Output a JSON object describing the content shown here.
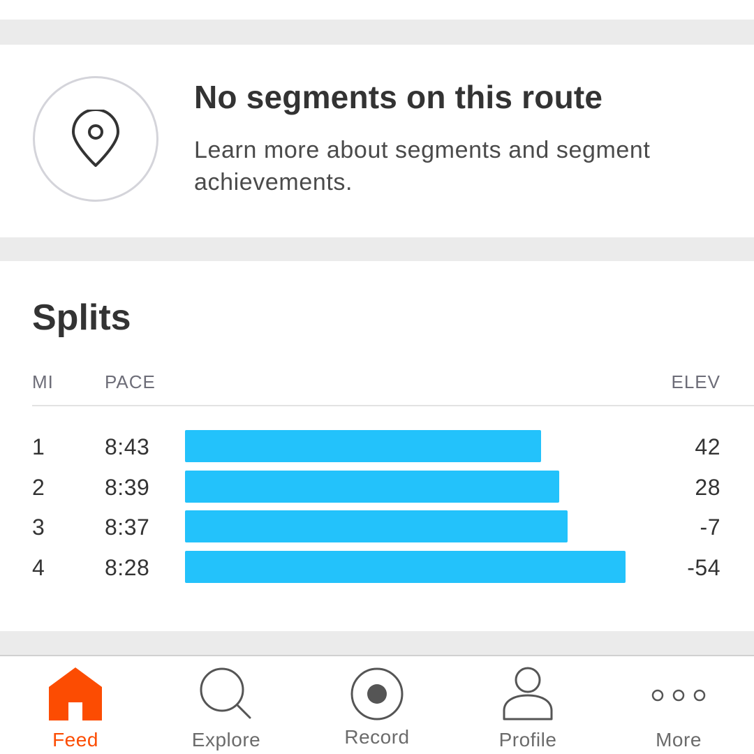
{
  "segments": {
    "title": "No segments on this route",
    "subtitle": "Learn more about segments and segment achievements."
  },
  "splits": {
    "title": "Splits",
    "headers": {
      "mi": "MI",
      "pace": "PACE",
      "elev": "ELEV"
    },
    "bar_color": "#23c2fb",
    "rows": [
      {
        "mi": "1",
        "pace": "8:43",
        "elev": "42",
        "bar_fraction": 0.809
      },
      {
        "mi": "2",
        "pace": "8:39",
        "elev": "28",
        "bar_fraction": 0.849
      },
      {
        "mi": "3",
        "pace": "8:37",
        "elev": "-7",
        "bar_fraction": 0.869
      },
      {
        "mi": "4",
        "pace": "8:28",
        "elev": "-54",
        "bar_fraction": 1.0
      }
    ]
  },
  "tabbar": {
    "accent_color": "#fc4c02",
    "tabs": [
      {
        "label": "Feed",
        "icon": "home-icon",
        "active": true
      },
      {
        "label": "Explore",
        "icon": "search-icon",
        "active": false
      },
      {
        "label": "Record",
        "icon": "record-icon",
        "active": false
      },
      {
        "label": "Profile",
        "icon": "person-icon",
        "active": false
      },
      {
        "label": "More",
        "icon": "more-icon",
        "active": false
      }
    ]
  }
}
